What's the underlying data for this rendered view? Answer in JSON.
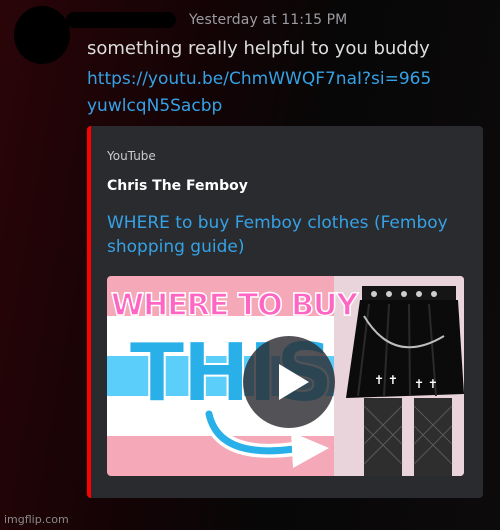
{
  "message": {
    "author_redacted": true,
    "timestamp": "Yesterday at 11:15 PM",
    "text": "something really helpful to you buddy",
    "link": "https://youtu.be/ChmWWQF7naI?si=965yuwlcqN5Sacbp"
  },
  "embed": {
    "provider": "YouTube",
    "author": "Chris The Femboy",
    "title": "WHERE to buy Femboy clothes (Femboy shopping guide)",
    "accent_color": "#ff0000",
    "thumbnail": {
      "line1": "WHERE TO BUY",
      "line2": "THIS",
      "flag_colors": [
        "#5bcefa",
        "#f5a9b8",
        "#ffffff"
      ],
      "icons": [
        "play-icon",
        "arrow-icon"
      ]
    }
  },
  "watermark": "imgflip.com",
  "colors": {
    "link": "#35a2e6",
    "text": "#dcddde",
    "muted": "#9a9ca1",
    "embed_bg": "#2a2b2f"
  }
}
